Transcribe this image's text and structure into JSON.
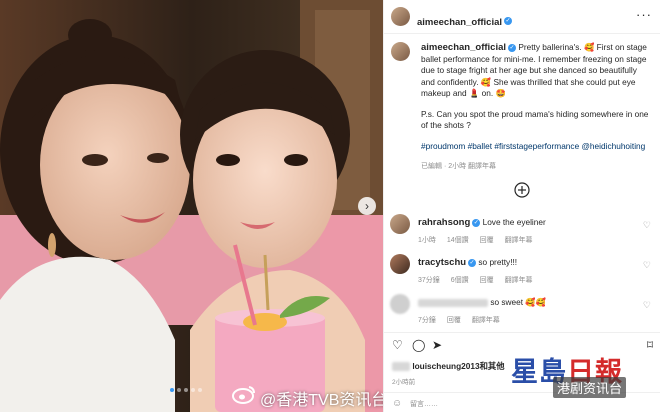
{
  "post": {
    "author": "aimeechan_official",
    "caption_p1": "Pretty ballerina's. 🥰 First on stage ballet performance for mini-me. I remember freezing on stage due to stage fright at her age but she danced so beautifully and confidently. 🥰 She was thrilled that she could put eye makeup and 💄 on. 🤩",
    "caption_p2": "P.s. Can you spot the proud mama's hiding somewhere in one of the shots ?",
    "hashtags": "#proudmom #ballet #firststageperformance @heidichuhoiting",
    "caption_meta": "已編輯 · 2小時  翻譯年幕"
  },
  "comments": [
    {
      "user": "rahrahsong",
      "verified": true,
      "text": "Love the eyeliner",
      "time": "1小時",
      "likes": "14個讚",
      "reply": "回覆",
      "translate": "翻譯年幕"
    },
    {
      "user": "tracytschu",
      "verified": true,
      "text": "so pretty!!!",
      "time": "37分鐘",
      "likes": "6個讚",
      "reply": "回覆",
      "translate": "翻譯年幕"
    },
    {
      "user": "",
      "verified": false,
      "text": "so sweet 🥰🥰",
      "time": "7分鐘",
      "likes": "",
      "reply": "回覆",
      "translate": "翻譯年幕"
    }
  ],
  "likes_line": "louischeung2013和其他",
  "time_ago": "2小時前",
  "add_comment": "留言……",
  "watermark": "@香港TVB资讯台",
  "brand_logo_a": "星島",
  "brand_logo_b": "日報",
  "brand_sub": "港剧资讯台",
  "icons": {
    "more": "more-icon",
    "heart": "heart-icon",
    "comment": "comment-icon",
    "share": "share-icon",
    "bookmark": "bookmark-icon"
  },
  "colors": {
    "link": "#00376b",
    "verified": "#3897f0",
    "muted": "#8e8e8e"
  }
}
